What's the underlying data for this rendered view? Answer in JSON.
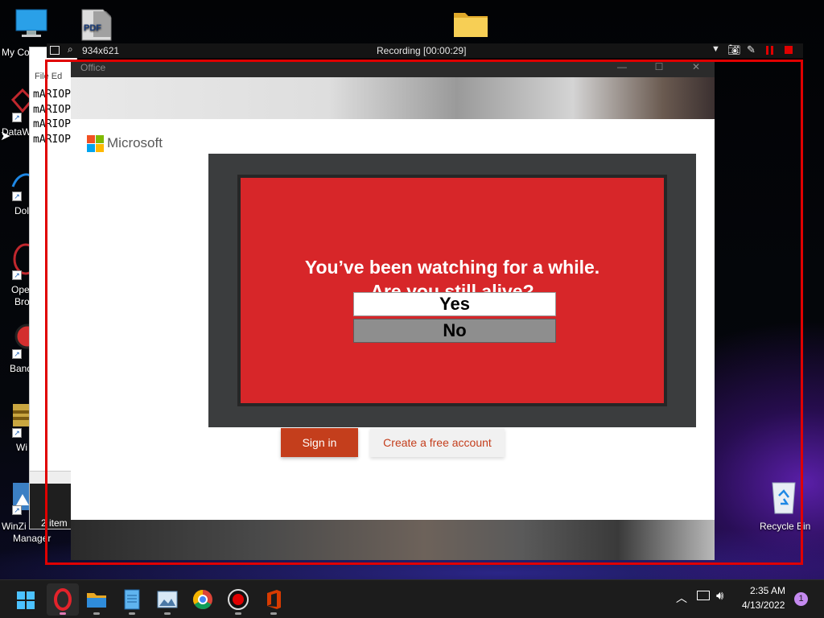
{
  "desktop": {
    "icons": {
      "my_computer": "My Co",
      "datawrapper": "DataW",
      "dolby": "Dol",
      "opera_1": "Ope",
      "opera_2": "Bro",
      "bandicam": "Band",
      "winrar": "Wi",
      "winzip_1": "WinZi",
      "winzip_2": "Manager",
      "recycle_bin": "Recycle Bin",
      "pdf_label": "PDF"
    }
  },
  "notepad": {
    "menu": "File  Ed",
    "lines": [
      "mARIOP",
      "mARIOP",
      "mARIOP",
      "mARIOP"
    ],
    "status_items": "2 item"
  },
  "recorder": {
    "size": "934x621",
    "status": "Recording [00:00:29]"
  },
  "office": {
    "window_title": "Office",
    "brand": "Microsoft",
    "signin_label": "Sign in",
    "create_label": "Create a free account",
    "colors": {
      "accent": "#c43e1c",
      "logo_red": "#f25022",
      "logo_green": "#7fba00",
      "logo_blue": "#00a4ef",
      "logo_yellow": "#ffb900"
    }
  },
  "popup": {
    "line1": "You’ve been watching for a while.",
    "line2": "Are you still alive?",
    "yes": "Yes",
    "no": "No",
    "colors": {
      "panel_red": "#d72629",
      "frame": "#3b3d3e"
    }
  },
  "taskbar": {
    "time": "2:35 AM",
    "date": "4/13/2022",
    "notification_count": "1",
    "apps": [
      "start-icon",
      "opera-icon",
      "file-explorer-icon",
      "notepad-icon",
      "photos-icon",
      "chrome-icon",
      "bandicam-icon",
      "office-icon"
    ]
  }
}
